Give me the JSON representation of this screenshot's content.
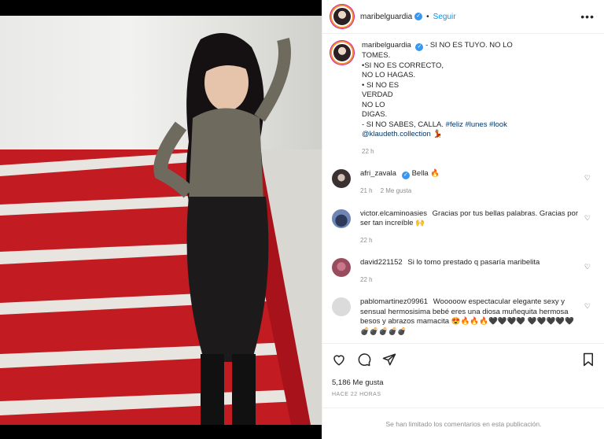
{
  "post": {
    "username": "maribelguardia",
    "follow_label": "Seguir",
    "dot": "•",
    "more": "•••"
  },
  "caption": {
    "author": "maribelguardia",
    "lines": [
      "- SI NO ES TUYO. NO LO",
      "TOMES.",
      "•SI NO ES CORRECTO,",
      "NO LO HAGAS.",
      "• SI NO ES",
      "VERDAD",
      "NO LO",
      "DIGAS.",
      "- SI NO SABES, CALLA."
    ],
    "hashtags": "#feliz #lunes #look",
    "mention": "@klaudeth.collection",
    "emoji": "💃",
    "time": "22 h"
  },
  "comments": [
    {
      "author": "afri_zavala",
      "text": "Bella 🔥",
      "time": "21 h",
      "likes": "2 Me gusta",
      "verified": "✓"
    },
    {
      "author": "victor.elcaminoasies",
      "text": "Gracias por tus bellas palabras. Gracias por ser tan increíble 🙌",
      "time": "22 h"
    },
    {
      "author": "david221152",
      "text": "Si lo tomo prestado q pasaría maribelita",
      "time": "22 h"
    },
    {
      "author": "pablomartinez09961",
      "text": "Wooooow espectacular elegante sexy y sensual hermosisima bebé eres una diosa muñequita hermosa besos y abrazos mamacita 😍🔥🔥🔥🖤🖤🖤🖤 🖤🖤🖤🖤🖤💣💣💣💣💣"
    }
  ],
  "footer": {
    "likes": "5,186 Me gusta",
    "timeago": "HACE 22 HORAS",
    "limited": "Se han limitado los comentarios en esta publicación."
  },
  "icons": {
    "heart": "heart-icon",
    "comment": "comment-icon",
    "share": "share-icon",
    "save": "bookmark-icon"
  },
  "colors": {
    "accent": "#0095f6",
    "verified": "#3897f0",
    "muted": "#8e8e8e",
    "stairs": "#b8141b"
  }
}
